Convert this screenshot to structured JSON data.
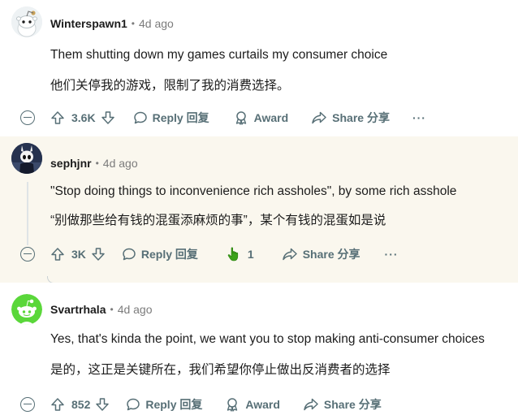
{
  "comments": [
    {
      "author": "Winterspawn1",
      "age": "4d ago",
      "body_en": "Them shutting down my games curtails my consumer choice",
      "body_zh": "他们关停我的游戏，限制了我的消费选择。",
      "votes": "3.6K",
      "reply_label": "Reply 回复",
      "award_label": "Award",
      "share_label": "Share 分享",
      "more_label": "···"
    },
    {
      "author": "sephjnr",
      "age": "4d ago",
      "body_en": "\"Stop doing things to inconvenience rich assholes\", by some rich asshole",
      "body_zh": "“别做那些给有钱的混蛋添麻烦的事”，某个有钱的混蛋如是说",
      "votes": "3K",
      "reply_label": "Reply 回复",
      "award_count": "1",
      "share_label": "Share 分享",
      "more_label": "···"
    },
    {
      "author": "Svartrhala",
      "age": "4d ago",
      "body_en": "Yes, that's kinda the point, we want you to stop making anti-consumer choices",
      "body_zh": "是的，这正是关键所在，我们希望你停止做出反消费者的选择",
      "votes": "852",
      "reply_label": "Reply 回复",
      "award_label": "Award",
      "share_label": "Share 分享"
    }
  ],
  "separator": "•",
  "colors": {
    "meta_text": "#576f76",
    "highlight_bg": "#faf7ee",
    "award_hand": "#3ca21a",
    "avatar_green": "#5ad73a"
  },
  "icons": {
    "upvote": "arrow-up-icon",
    "downvote": "arrow-down-icon",
    "reply": "speech-bubble-icon",
    "award": "award-ribbon-icon",
    "share": "share-arrow-icon",
    "collapse": "collapse-minus-icon"
  }
}
